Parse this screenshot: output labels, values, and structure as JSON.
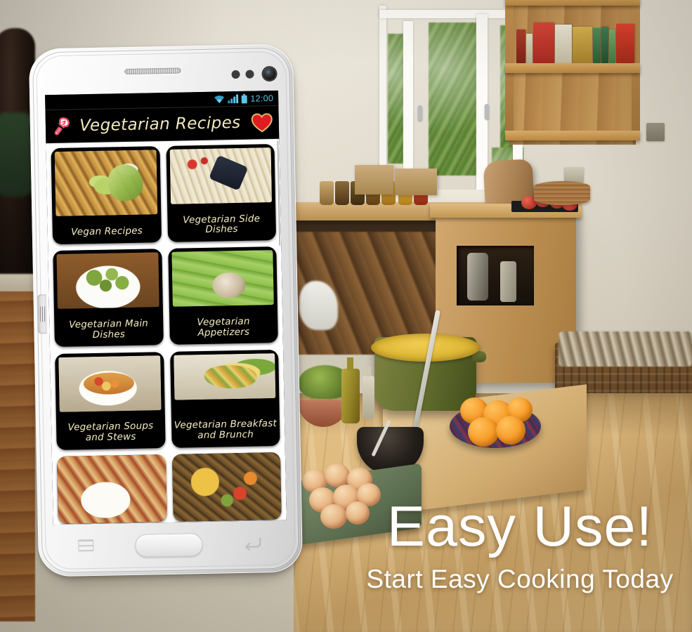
{
  "statusbar": {
    "time": "12:00",
    "icons": [
      "wifi-icon",
      "signal-icon",
      "battery-icon"
    ],
    "accent_color": "#59c6e6"
  },
  "appbar": {
    "title": "Vegetarian Recipes",
    "logo_icon": "chef-bulb-logo-icon",
    "favorite_icon": "heart-icon",
    "title_color": "#f2e9bd",
    "background_color": "#000000"
  },
  "grid": {
    "tiles": [
      {
        "label": "Vegan Recipes",
        "thumb": "vegan-skillet-avocado-photo"
      },
      {
        "label": "Vegetarian Side Dishes",
        "thumb": "roasted-vegetable-tray-photo"
      },
      {
        "label": "Vegetarian Main Dishes",
        "thumb": "green-gnocchi-bowl-photo"
      },
      {
        "label": "Vegetarian Appetizers",
        "thumb": "cucumber-rolls-photo"
      },
      {
        "label": "Vegetarian Soups and Stews",
        "thumb": "vegetable-stew-bowl-photo"
      },
      {
        "label": "Vegetarian Breakfast and Brunch",
        "thumb": "brunch-scramble-photo"
      },
      {
        "label": "",
        "thumb": "tofu-in-sauce-photo"
      },
      {
        "label": "",
        "thumb": "grilled-corn-skewers-photo"
      }
    ]
  },
  "phone": {
    "device": "white-smartphone",
    "nav": {
      "menu_icon": "menu-icon",
      "home_button": "home-button",
      "back_icon": "back-icon"
    },
    "hardware": {
      "speaker": "earpiece-speaker",
      "camera": "front-camera-icon",
      "sensors": "proximity-sensors",
      "volume": "volume-rocker"
    }
  },
  "promo": {
    "headline": "Easy Use!",
    "subhead": "Start Easy Cooking Today",
    "text_color": "#ffffff"
  },
  "background": {
    "scene": "kitchen-with-wooden-table",
    "wall_color": "#e9e3d6",
    "wood_color": "#d9b67c"
  }
}
